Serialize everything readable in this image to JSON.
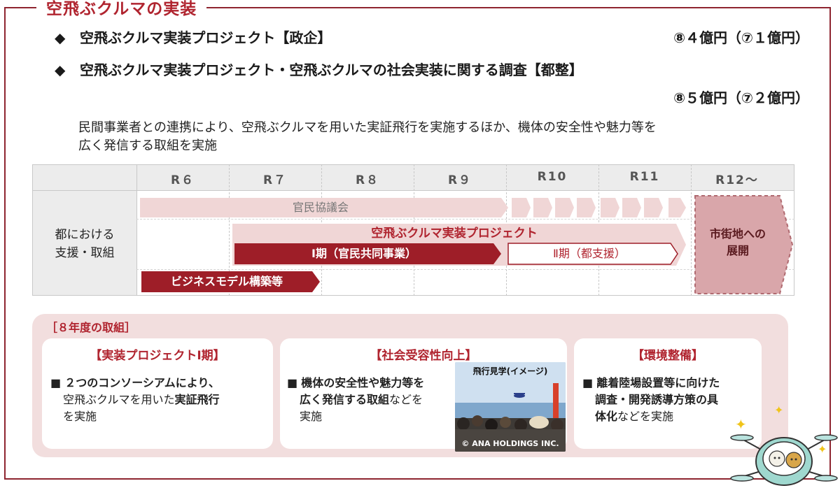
{
  "section_title": "空飛ぶクルマの実装",
  "bullets": [
    {
      "marker": "◆",
      "label": "空飛ぶクルマ実装プロジェクト【政企】",
      "budget": "⑧４億円（⑦１億円）"
    },
    {
      "marker": "◆",
      "label": "空飛ぶクルマ実装プロジェクト・空飛ぶクルマの社会実装に関する調査【都整】",
      "budget": "⑧５億円（⑦２億円）"
    }
  ],
  "description": {
    "line1": "民間事業者との連携により、空飛ぶクルマを用いた実証飛行を実施するほか、機体の安全性や魅力等を",
    "line2": "広く発信する取組を実施"
  },
  "timeline": {
    "years": [
      "R６",
      "R７",
      "R８",
      "R９",
      "R10",
      "R11",
      "R12～"
    ],
    "row_label_line1": "都における",
    "row_label_line2": "支援・取組",
    "bars": {
      "council": "官民協議会",
      "project": "空飛ぶクルマ実装プロジェクト",
      "phase1": "Ⅰ期（官民共同事業）",
      "phase2": "Ⅱ期（都支援）",
      "business": "ビジネスモデル構築等",
      "expansion_line1": "市街地への",
      "expansion_line2": "展開"
    }
  },
  "panel": {
    "title": "［８年度の取組］",
    "cards": [
      {
        "title": "【実装プロジェクトⅠ期】",
        "bullet": "■",
        "line1": "２つのコンソーシアムにより、",
        "line2_pre": "空飛ぶクルマを用いた",
        "line2_bold": "実証飛行",
        "line3": "を実施"
      },
      {
        "title": "【社会受容性向上】",
        "bullet": "■",
        "line1": "機体の安全性や魅力等を",
        "line2_bold": "広く発信する取組",
        "line2_post": "などを",
        "line3": "実施",
        "photo_caption": "飛行見学(イメージ)",
        "photo_credit": "© ANA HOLDINGS INC."
      },
      {
        "title": "【環境整備】",
        "bullet": "■",
        "line1": "離着陸場設置等に向けた",
        "line2": "調査・開発誘導方策の具",
        "line3_bold": "体化",
        "line3_post": "などを実施"
      }
    ]
  },
  "colors": {
    "accent": "#b0242f",
    "dark_bar": "#9e1e28",
    "light_bar": "#f0d6d6",
    "expansion": "#d9a6aa",
    "panel_bg": "#f2dede"
  }
}
